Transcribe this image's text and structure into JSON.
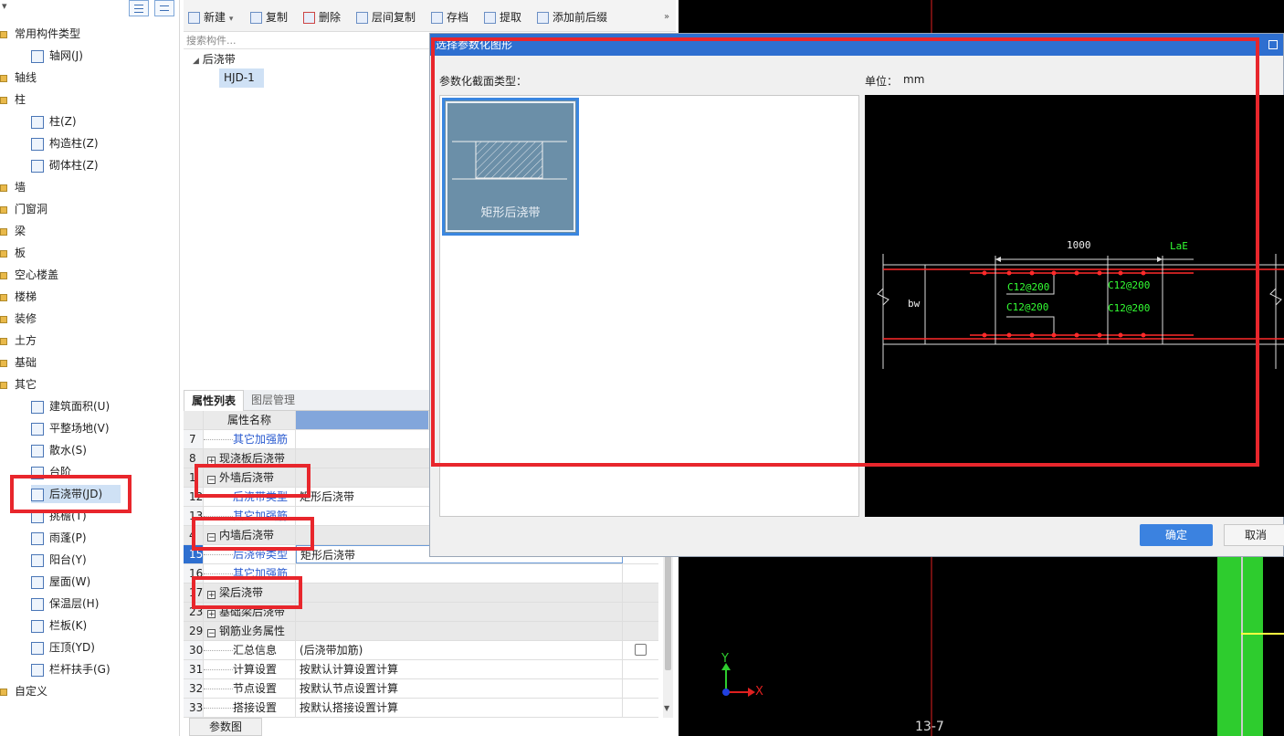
{
  "left_tree": {
    "items": [
      {
        "label": "常用构件类型",
        "type": "folder"
      },
      {
        "label": "轴网(J)",
        "type": "leaf"
      },
      {
        "label": "轴线",
        "type": "folder"
      },
      {
        "label": "柱",
        "type": "folder"
      },
      {
        "label": "柱(Z)",
        "type": "leaf"
      },
      {
        "label": "构造柱(Z)",
        "type": "leaf"
      },
      {
        "label": "砌体柱(Z)",
        "type": "leaf"
      },
      {
        "label": "墙",
        "type": "folder"
      },
      {
        "label": "门窗洞",
        "type": "folder"
      },
      {
        "label": "梁",
        "type": "folder"
      },
      {
        "label": "板",
        "type": "folder"
      },
      {
        "label": "空心楼盖",
        "type": "folder"
      },
      {
        "label": "楼梯",
        "type": "folder"
      },
      {
        "label": "装修",
        "type": "folder"
      },
      {
        "label": "土方",
        "type": "folder"
      },
      {
        "label": "基础",
        "type": "folder"
      },
      {
        "label": "其它",
        "type": "folder"
      },
      {
        "label": "建筑面积(U)",
        "type": "leaf"
      },
      {
        "label": "平整场地(V)",
        "type": "leaf"
      },
      {
        "label": "散水(S)",
        "type": "leaf"
      },
      {
        "label": "台阶",
        "type": "leaf"
      },
      {
        "label": "后浇带(JD)",
        "type": "leaf"
      },
      {
        "label": "挑檐(T)",
        "type": "leaf"
      },
      {
        "label": "雨蓬(P)",
        "type": "leaf"
      },
      {
        "label": "阳台(Y)",
        "type": "leaf"
      },
      {
        "label": "屋面(W)",
        "type": "leaf"
      },
      {
        "label": "保温层(H)",
        "type": "leaf"
      },
      {
        "label": "栏板(K)",
        "type": "leaf"
      },
      {
        "label": "压顶(YD)",
        "type": "leaf"
      },
      {
        "label": "栏杆扶手(G)",
        "type": "leaf"
      },
      {
        "label": "自定义",
        "type": "folder"
      }
    ]
  },
  "toolbar": {
    "new_label": "新建",
    "copy_label": "复制",
    "delete_label": "删除",
    "floor_copy_label": "层间复制",
    "save_label": "存档",
    "extract_label": "提取",
    "add_prefix_label": "添加前后缀"
  },
  "component_tree": {
    "search_placeholder": "搜索构件...",
    "group_label": "后浇带",
    "item_label": "HJD-1"
  },
  "props": {
    "tab_active": "属性列表",
    "tab_other": "图层管理",
    "header_name": "属性名称",
    "rows": [
      {
        "num": "7",
        "name": "其它加强筋",
        "value": "",
        "kind": "link"
      },
      {
        "num": "8",
        "name": "现浇板后浇带",
        "value": "",
        "kind": "group-plus"
      },
      {
        "num": "1",
        "name": "外墙后浇带",
        "value": "",
        "kind": "group-minus"
      },
      {
        "num": "12",
        "name": "后浇带类型",
        "value": "矩形后浇带",
        "kind": "link"
      },
      {
        "num": "13",
        "name": "其它加强筋",
        "value": "",
        "kind": "link"
      },
      {
        "num": "4",
        "name": "内墙后浇带",
        "value": "",
        "kind": "group-minus"
      },
      {
        "num": "15",
        "name": "后浇带类型",
        "value": "矩形后浇带",
        "kind": "link-active"
      },
      {
        "num": "16",
        "name": "其它加强筋",
        "value": "",
        "kind": "link"
      },
      {
        "num": "17",
        "name": "梁后浇带",
        "value": "",
        "kind": "group-plus"
      },
      {
        "num": "23",
        "name": "基础梁后浇带",
        "value": "",
        "kind": "group-plus"
      },
      {
        "num": "29",
        "name": "钢筋业务属性",
        "value": "",
        "kind": "group-minus"
      },
      {
        "num": "30",
        "name": "汇总信息",
        "value": "(后浇带加筋)",
        "kind": "child-check"
      },
      {
        "num": "31",
        "name": "计算设置",
        "value": "按默认计算设置计算",
        "kind": "child"
      },
      {
        "num": "32",
        "name": "节点设置",
        "value": "按默认节点设置计算",
        "kind": "child"
      },
      {
        "num": "33",
        "name": "搭接设置",
        "value": "按默认搭接设置计算",
        "kind": "child"
      }
    ],
    "bottom_tab": "参数图"
  },
  "dialog": {
    "title": "选择参数化图形",
    "section_type_label": "参数化截面类型：",
    "unit_label": "单位：",
    "unit_value": "mm",
    "shape_label": "矩形后浇带",
    "ok_label": "确定",
    "cancel_label": "取消"
  },
  "preview": {
    "dim_width": "1000",
    "dim_lae": "LaE",
    "dim_bw": "bw",
    "rebar_tl": "C12@200",
    "rebar_tr": "C12@200",
    "rebar_bl": "C12@200",
    "rebar_br": "C12@200"
  },
  "cad": {
    "axis_y": "Y",
    "axis_x": "X",
    "grid_label": "13-7"
  },
  "colors": {
    "highlight": "#e8262c",
    "accent": "#2e6fd0",
    "cad_background": "#000000",
    "rebar": "#ff2a2a",
    "dimension_text": "#33ff33"
  }
}
